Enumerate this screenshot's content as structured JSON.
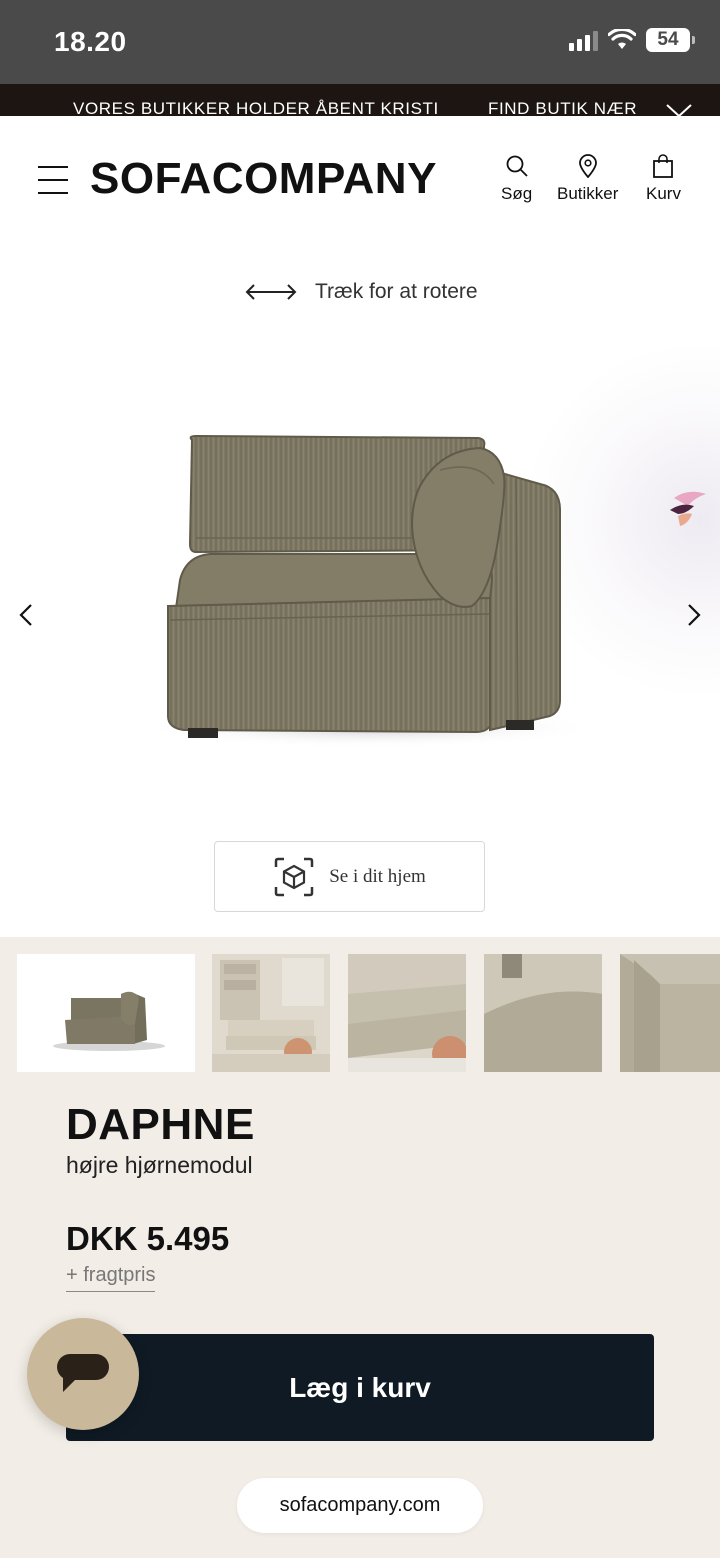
{
  "status_bar": {
    "time": "18.20",
    "battery": "54",
    "icons": [
      "cellular-signal-icon",
      "wifi-icon",
      "battery-icon"
    ]
  },
  "announcement": {
    "text": "VORES BUTIKKER HOLDER ÅBENT KRISTI",
    "link": "FIND BUTIK NÆR",
    "icon": "chevron-down-icon"
  },
  "header": {
    "logo": "SOFACOMPANY",
    "menu_icon": "hamburger-menu-icon",
    "nav": [
      {
        "label": "Søg",
        "icon": "search-icon"
      },
      {
        "label": "Butikker",
        "icon": "location-pin-icon"
      },
      {
        "label": "Kurv",
        "icon": "shopping-bag-icon"
      }
    ]
  },
  "viewer": {
    "rotate_hint": "Træk for at rotere",
    "ar_button_label": "Se i dit hjem",
    "colors": {
      "fabric": "#7d7763",
      "fabric_dark": "#5f5a49"
    }
  },
  "thumbnails": {
    "count": 5,
    "selected_index": 0
  },
  "product": {
    "name": "DAPHNE",
    "subtitle": "højre hjørnemodul",
    "price": "DKK 5.495",
    "shipping": "+ fragtpris",
    "add_to_cart": "Læg i kurv"
  },
  "browser": {
    "url": "sofacompany.com"
  },
  "theme": {
    "accent_dark": "#0f1a24",
    "page_bg": "#f2ede6",
    "chat_bubble": "#c9b99a"
  }
}
